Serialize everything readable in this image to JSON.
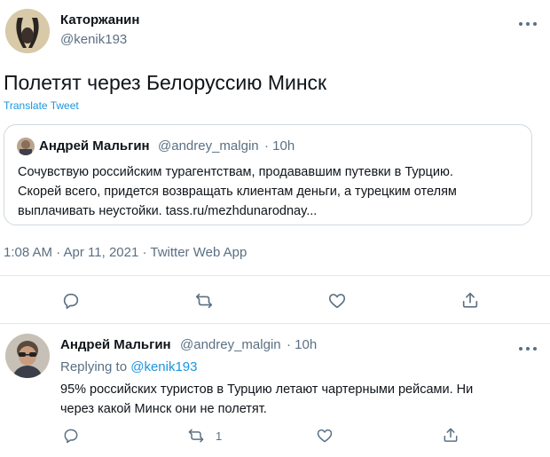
{
  "main_tweet": {
    "author_name": "Каторжанин",
    "author_handle": "@kenik193",
    "text": "Полетят через Белоруссию Минск",
    "translate_label": "Translate Tweet",
    "timestamp": "1:08 AM · Apr 11, 2021 · Twitter Web App"
  },
  "quoted_tweet": {
    "author_name": "Андрей Мальгин",
    "author_handle": "@andrey_malgin",
    "age": "· 10h",
    "line1": "Сочувствую российским турагентствам, продававшим путевки в Турцию.",
    "line2": "Скорей всего, придется возвращать клиентам деньги, а турецким отелям",
    "line3": "выплачивать неустойки. tass.ru/mezhdunarodnay..."
  },
  "reply": {
    "author_name": "Андрей Мальгин",
    "author_handle": "@andrey_malgin",
    "age": "· 10h",
    "replying_to_label": "Replying to",
    "replying_to_handle": "@kenik193",
    "line1": "95% российских туристов в Турцию летают чартерными рейсами. Ни",
    "line2": "через какой Минск они не полетят.",
    "retweet_count": "1"
  },
  "icons": {
    "more": "more-horizontal-icon",
    "reply": "reply-icon",
    "retweet": "retweet-icon",
    "like": "heart-icon",
    "share": "share-icon"
  },
  "colors": {
    "link": "#1b95e0",
    "muted": "#5b7083",
    "border": "#cfd9de"
  }
}
